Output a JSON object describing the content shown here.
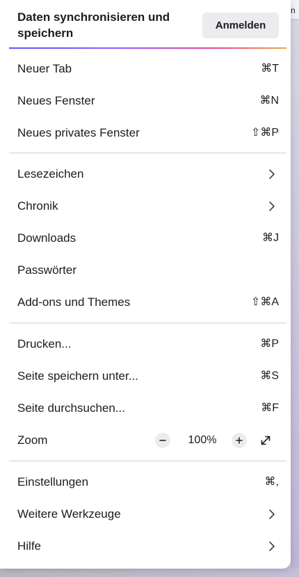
{
  "corner_tab": "An",
  "header": {
    "title": "Daten synchronisieren und speichern",
    "signin_label": "Anmelden"
  },
  "items": {
    "new_tab": {
      "label": "Neuer Tab",
      "shortcut": "⌘T"
    },
    "new_window": {
      "label": "Neues Fenster",
      "shortcut": "⌘N"
    },
    "new_private_window": {
      "label": "Neues privates Fenster",
      "shortcut": "⇧⌘P"
    },
    "bookmarks": {
      "label": "Lesezeichen"
    },
    "history": {
      "label": "Chronik"
    },
    "downloads": {
      "label": "Downloads",
      "shortcut": "⌘J"
    },
    "passwords": {
      "label": "Passwörter"
    },
    "addons": {
      "label": "Add-ons und Themes",
      "shortcut": "⇧⌘A"
    },
    "print": {
      "label": "Drucken...",
      "shortcut": "⌘P"
    },
    "save_page": {
      "label": "Seite speichern unter...",
      "shortcut": "⌘S"
    },
    "find": {
      "label": "Seite durchsuchen...",
      "shortcut": "⌘F"
    },
    "zoom": {
      "label": "Zoom",
      "value": "100%"
    },
    "settings": {
      "label": "Einstellungen",
      "shortcut": "⌘,"
    },
    "more_tools": {
      "label": "Weitere Werkzeuge"
    },
    "help": {
      "label": "Hilfe"
    }
  },
  "icons": {
    "submenu": "chevron-right-icon",
    "zoom_out": "minus-icon",
    "zoom_in": "plus-icon",
    "fullscreen": "expand-icon"
  },
  "colors": {
    "text": "#1c1b22",
    "button_bg": "#ececee",
    "separator": "#d0d0d5",
    "accent_start": "#5b59f0",
    "accent_mid": "#9059ff",
    "accent_pink": "#e3488d",
    "accent_end": "#f0a64a"
  }
}
